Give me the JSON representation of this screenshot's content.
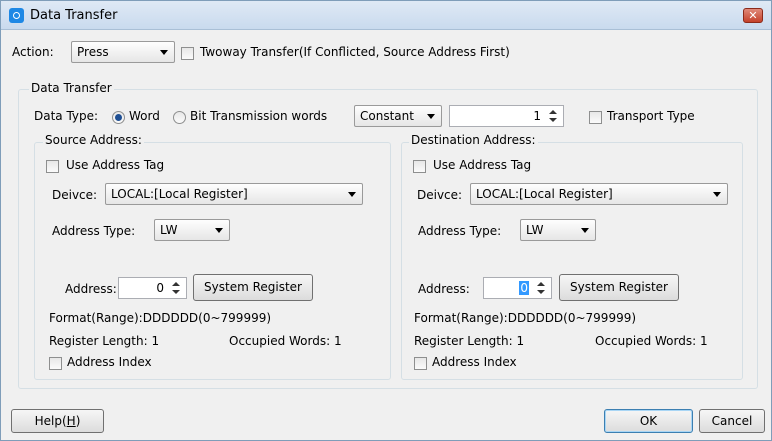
{
  "window": {
    "title": "Data Transfer",
    "close_glyph": "✕"
  },
  "action": {
    "label": "Action:",
    "value": "Press",
    "twoway_label": "Twoway Transfer(If Conflicted, Source Address First)",
    "twoway_checked": false
  },
  "data_transfer": {
    "group_label": "Data Transfer",
    "data_type_label": "Data Type:",
    "radio_word": "Word",
    "radio_bit": "Bit Transmission words",
    "selected_radio": "Word",
    "mode_value": "Constant",
    "count_value": "1",
    "transport_label": "Transport Type",
    "transport_checked": false
  },
  "source": {
    "group_label": "Source Address:",
    "use_tag_label": "Use Address Tag",
    "device_label": "Deivce:",
    "device_value": "LOCAL:[Local Register]",
    "addr_type_label": "Address Type:",
    "addr_type_value": "LW",
    "address_label": "Address:",
    "address_value": "0",
    "sysreg_label": "System Register",
    "format_text": "Format(Range):DDDDDD(0~799999)",
    "reg_length_text": "Register Length: 1",
    "occupied_text": "Occupied Words: 1",
    "index_label": "Address Index"
  },
  "destination": {
    "group_label": "Destination Address:",
    "use_tag_label": "Use Address Tag",
    "device_label": "Deivce:",
    "device_value": "LOCAL:[Local Register]",
    "addr_type_label": "Address Type:",
    "addr_type_value": "LW",
    "address_label": "Address:",
    "address_value": "0",
    "sysreg_label": "System Register",
    "format_text": "Format(Range):DDDDDD(0~799999)",
    "reg_length_text": "Register Length: 1",
    "occupied_text": "Occupied Words: 1",
    "index_label": "Address Index"
  },
  "buttons": {
    "help_prefix": "Help(",
    "help_key": "H",
    "help_suffix": ")",
    "ok": "OK",
    "cancel": "Cancel"
  }
}
